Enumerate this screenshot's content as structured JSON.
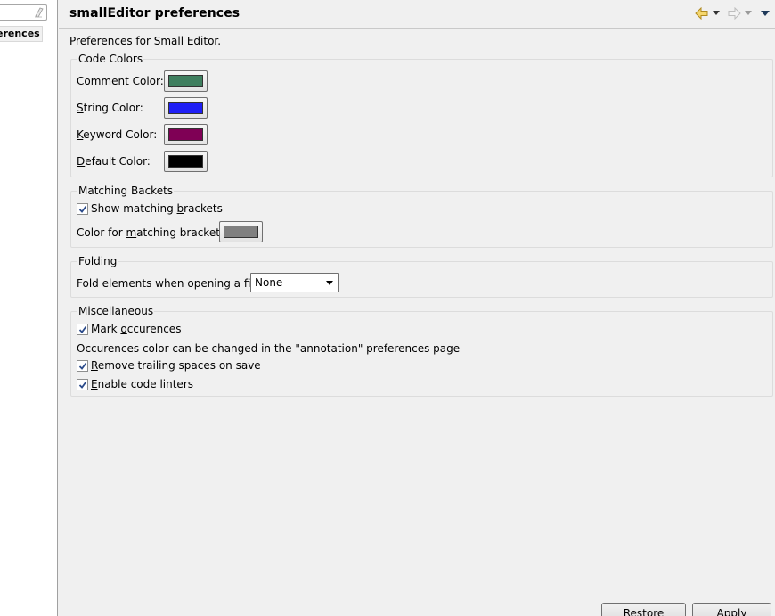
{
  "sidebar": {
    "filter_placeholder": "",
    "selected_item": "erences"
  },
  "header": {
    "title": "smallEditor preferences"
  },
  "description": "Preferences for Small Editor.",
  "code_colors": {
    "title": "Code Colors",
    "items": [
      {
        "label": "Comment Color:",
        "color": "#3f7f5f"
      },
      {
        "label": "String Color:",
        "color": "#1f1ff5"
      },
      {
        "label": "Keyword Color:",
        "color": "#7f0055"
      },
      {
        "label": "Default Color:",
        "color": "#000000"
      }
    ]
  },
  "matching": {
    "title": "Matching Backets",
    "show_label": "Show matching brackets",
    "show_checked": true,
    "color_label": "Color for matching brackets:",
    "color": "#808080"
  },
  "folding": {
    "title": "Folding",
    "label": "Fold elements when opening a file :",
    "value": "None"
  },
  "misc": {
    "title": "Miscellaneous",
    "mark_label": "Mark occurences",
    "note": "Occurences color can be changed in the \"annotation\" preferences page",
    "trailing_label": "Remove trailing spaces on save",
    "linters_label": "Enable code linters"
  },
  "buttons": {
    "restore": "Restore Defaults",
    "apply": "Apply"
  }
}
